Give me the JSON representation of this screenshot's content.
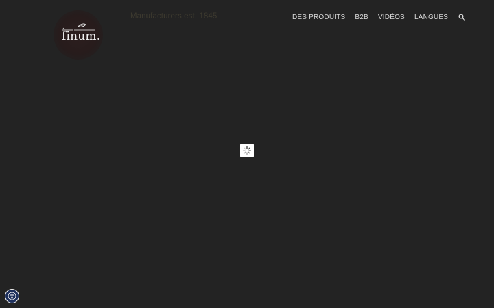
{
  "header": {
    "logo_text": "finum.",
    "tagline": "Manufacturers est. 1845"
  },
  "nav": {
    "items": [
      {
        "label": "DES PRODUITS"
      },
      {
        "label": "B2B"
      },
      {
        "label": "VIDÉOS"
      },
      {
        "label": "LANGUES"
      }
    ],
    "search_icon": "search-icon"
  },
  "loader": {
    "icon": "spinner-icon"
  },
  "accessibility": {
    "icon": "accessibility-icon"
  },
  "colors": {
    "background": "#232323",
    "nav_text": "#d9d9d9",
    "tagline_text": "#3d3a2f",
    "accessibility_button": "#1d2f5c"
  }
}
